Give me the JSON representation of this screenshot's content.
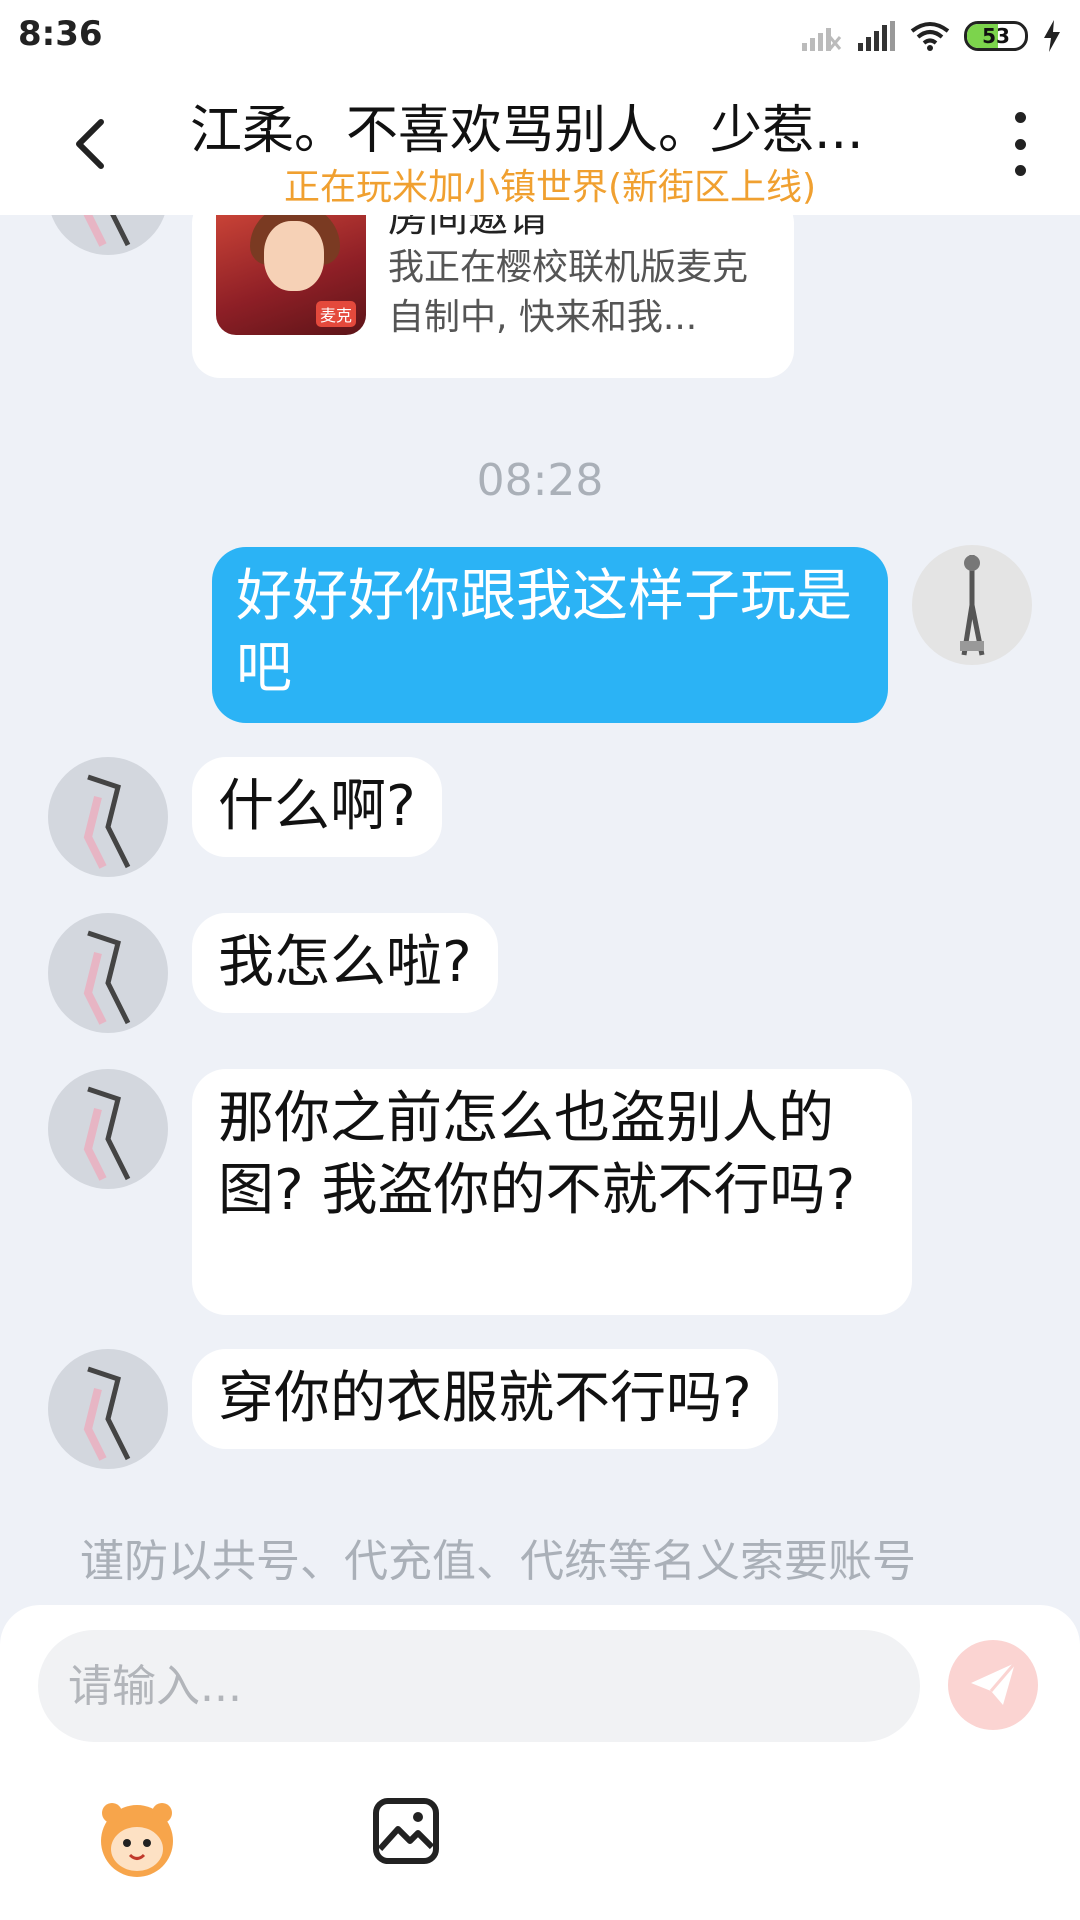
{
  "status_bar": {
    "time": "8:36",
    "battery": "53",
    "battery_level": 0.53
  },
  "header": {
    "title": "江柔。不喜欢骂别人。少惹...",
    "subtitle": "正在玩米加小镇世界(新街区上线)"
  },
  "chat": {
    "invite_card": {
      "title": "房间邀请",
      "description": "我正在樱校联机版麦克自制中, 快来和我...",
      "thumb_tag": "麦克"
    },
    "timestamp": "08:28",
    "messages": [
      {
        "sender": "me",
        "text": "好好好你跟我这样子玩是吧"
      },
      {
        "sender": "other",
        "text": "什么啊?"
      },
      {
        "sender": "other",
        "text": "我怎么啦?"
      },
      {
        "sender": "other",
        "text": "那你之前怎么也盗别人的图? 我盗你的不就不行吗?"
      },
      {
        "sender": "other",
        "text": "穿你的衣服就不行吗?"
      }
    ],
    "notice": "谨防以共号、代充值、代练等名义索要账号"
  },
  "input": {
    "placeholder": "请输入..."
  },
  "icons": {
    "back": "back-arrow-icon",
    "more": "more-vertical-icon",
    "send": "send-icon",
    "emoji": "emoji-icon",
    "image": "image-icon"
  },
  "colors": {
    "my_bubble": "#2bb3f5",
    "subtitle": "#f0a030",
    "send_button": "#fbd4d2",
    "chat_background": "#eef1f7"
  }
}
